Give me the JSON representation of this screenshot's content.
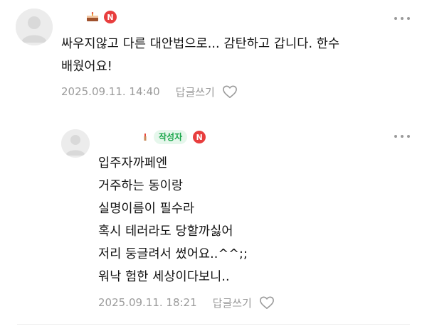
{
  "comments": [
    {
      "content_lines": [
        "싸우지않고 다른 대안법으로... 감탄하고 갑니다. 한수",
        "배웠어요!"
      ],
      "badge": "N",
      "date": "2025.09.11. 14:40",
      "reply_label": "답글쓰기"
    },
    {
      "author_tag": "작성자",
      "content_lines": [
        "입주자까페엔",
        "거주하는 동이랑",
        "실명이름이 필수라",
        "혹시 테러라도 당할까싫어",
        "저리 둥글려서 썼어요..^^;;",
        "워낙 험한 세상이다보니.."
      ],
      "badge": "N",
      "date": "2025.09.11. 18:21",
      "reply_label": "답글쓰기"
    }
  ],
  "icons": {
    "more": "more-dots-icon",
    "like": "heart-outline-icon",
    "avatar": "default-avatar-icon"
  },
  "colors": {
    "badge_red": "#e83e3e",
    "author_tag_bg": "#e6f7ec",
    "author_tag_text": "#1aa64a",
    "meta_gray": "#9b9b9b"
  }
}
